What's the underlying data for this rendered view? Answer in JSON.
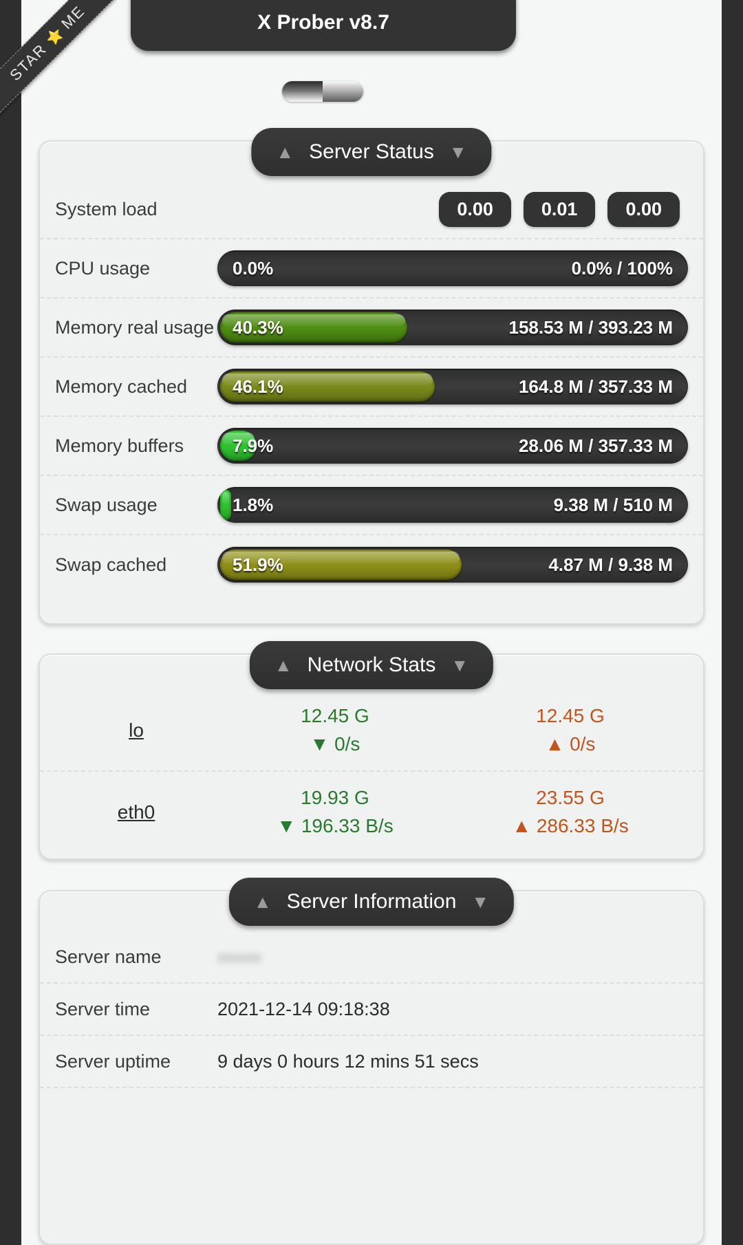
{
  "ribbon": {
    "text_left": "STAR",
    "star": "⭐",
    "text_right": "ME"
  },
  "header": {
    "title": "X Prober v8.7"
  },
  "toggle": {
    "name": "theme-toggle"
  },
  "icons": {
    "collapse_up": "▲",
    "collapse_down": "▼",
    "down_arrow": "▼",
    "up_arrow": "▲"
  },
  "colors": {
    "accent_green": "#2a7a2e",
    "accent_orange": "#c1551c",
    "bar_track": "#2e2e2e",
    "header_dark": "#333333",
    "panel_bg": "#f0f1f1"
  },
  "sections": {
    "server_status": {
      "title": "Server Status",
      "rows": {
        "system_load": {
          "label": "System load",
          "values": [
            "0.00",
            "0.01",
            "0.00"
          ]
        },
        "cpu_usage": {
          "label": "CPU usage",
          "percent_text": "0.0%",
          "percent": 0,
          "amount": "0.0% / 100%",
          "color": "none"
        },
        "memory_real": {
          "label": "Memory real usage",
          "percent_text": "40.3%",
          "percent": 40.3,
          "amount": "158.53 M / 393.23 M",
          "color": "#4e8c12"
        },
        "memory_cached": {
          "label": "Memory cached",
          "percent_text": "46.1%",
          "percent": 46.1,
          "amount": "164.8 M / 357.33 M",
          "color": "#79891a"
        },
        "memory_buffers": {
          "label": "Memory buffers",
          "percent_text": "7.9%",
          "percent": 7.9,
          "amount": "28.06 M / 357.33 M",
          "color": "#2fc22f"
        },
        "swap_usage": {
          "label": "Swap usage",
          "percent_text": "1.8%",
          "percent": 1.8,
          "amount": "9.38 M / 510 M",
          "color": "#2fc22f"
        },
        "swap_cached": {
          "label": "Swap cached",
          "percent_text": "51.9%",
          "percent": 51.9,
          "amount": "4.87 M / 9.38 M",
          "color": "#8d8f18"
        }
      }
    },
    "network_stats": {
      "title": "Network Stats",
      "interfaces": [
        {
          "name": "lo",
          "rx_total": "12.45 G",
          "rx_speed": "0/s",
          "tx_total": "12.45 G",
          "tx_speed": "0/s"
        },
        {
          "name": "eth0",
          "rx_total": "19.93 G",
          "rx_speed": "196.33 B/s",
          "tx_total": "23.55 G",
          "tx_speed": "286.33 B/s"
        }
      ]
    },
    "server_information": {
      "title": "Server Information",
      "rows": [
        {
          "label": "Server name",
          "value": "",
          "hidden": true
        },
        {
          "label": "Server time",
          "value": "2021-12-14 09:18:38"
        },
        {
          "label": "Server uptime",
          "value": "9 days 0 hours 12 mins 51 secs"
        }
      ]
    }
  }
}
